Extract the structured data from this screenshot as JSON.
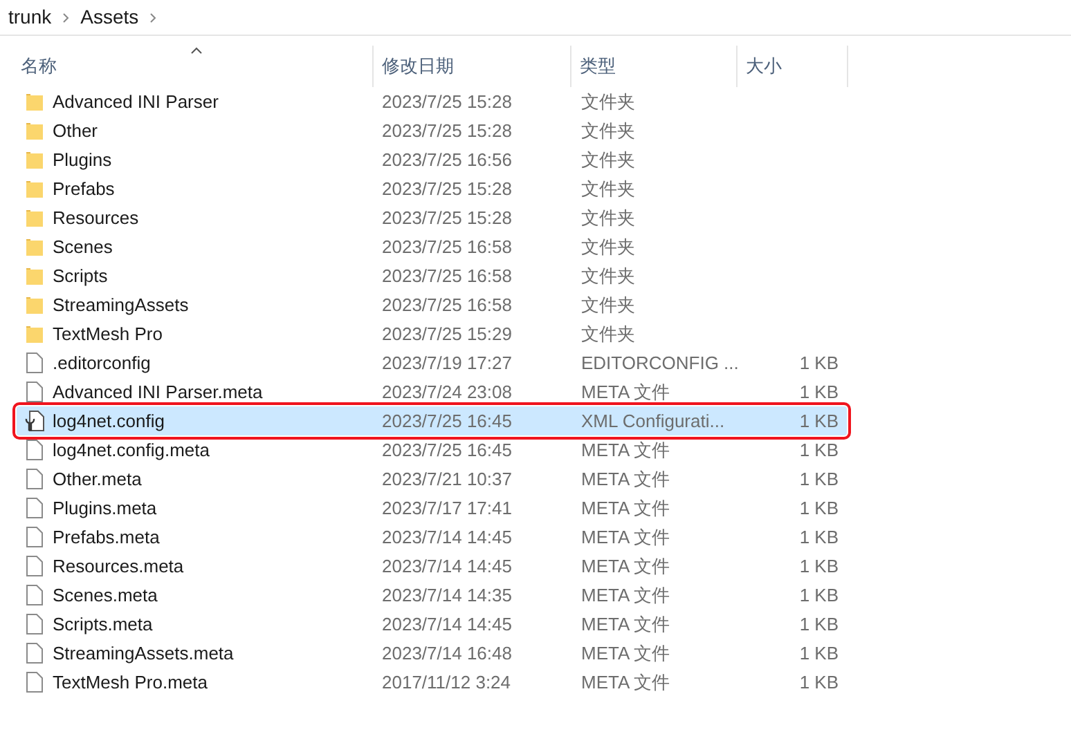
{
  "breadcrumb": [
    "trunk",
    "Assets"
  ],
  "columns": [
    {
      "label": "名称",
      "sorted": true
    },
    {
      "label": "修改日期",
      "sorted": false
    },
    {
      "label": "类型",
      "sorted": false
    },
    {
      "label": "大小",
      "sorted": false
    }
  ],
  "rows": [
    {
      "kind": "folder",
      "name": "Advanced INI Parser",
      "date": "2023/7/25 15:28",
      "type": "文件夹",
      "selected": false,
      "outlined": false
    },
    {
      "kind": "folder",
      "name": "Other",
      "date": "2023/7/25 15:28",
      "type": "文件夹",
      "selected": false,
      "outlined": false
    },
    {
      "kind": "folder",
      "name": "Plugins",
      "date": "2023/7/25 16:56",
      "type": "文件夹",
      "selected": false,
      "outlined": false
    },
    {
      "kind": "folder",
      "name": "Prefabs",
      "date": "2023/7/25 15:28",
      "type": "文件夹",
      "selected": false,
      "outlined": false
    },
    {
      "kind": "folder",
      "name": "Resources",
      "date": "2023/7/25 15:28",
      "type": "文件夹",
      "selected": false,
      "outlined": false
    },
    {
      "kind": "folder",
      "name": "Scenes",
      "date": "2023/7/25 16:58",
      "type": "文件夹",
      "selected": false,
      "outlined": false
    },
    {
      "kind": "folder",
      "name": "Scripts",
      "date": "2023/7/25 16:58",
      "type": "文件夹",
      "selected": false,
      "outlined": false
    },
    {
      "kind": "folder",
      "name": "StreamingAssets",
      "date": "2023/7/25 16:58",
      "type": "文件夹",
      "selected": false,
      "outlined": false
    },
    {
      "kind": "folder",
      "name": "TextMesh Pro",
      "date": "2023/7/25 15:29",
      "type": "文件夹",
      "selected": false,
      "outlined": false
    },
    {
      "kind": "file",
      "name": ".editorconfig",
      "date": "2023/7/19 17:27",
      "type": "EDITORCONFIG ...",
      "size": "1 KB",
      "selected": false,
      "outlined": false
    },
    {
      "kind": "file",
      "name": "Advanced INI Parser.meta",
      "date": "2023/7/24 23:08",
      "type": "META 文件",
      "size": "1 KB",
      "selected": false,
      "outlined": false
    },
    {
      "kind": "config",
      "name": "log4net.config",
      "date": "2023/7/25 16:45",
      "type": "XML Configurati...",
      "size": "1 KB",
      "selected": true,
      "outlined": true
    },
    {
      "kind": "file",
      "name": "log4net.config.meta",
      "date": "2023/7/25 16:45",
      "type": "META 文件",
      "size": "1 KB",
      "selected": false,
      "outlined": false
    },
    {
      "kind": "file",
      "name": "Other.meta",
      "date": "2023/7/21 10:37",
      "type": "META 文件",
      "size": "1 KB",
      "selected": false,
      "outlined": false
    },
    {
      "kind": "file",
      "name": "Plugins.meta",
      "date": "2023/7/17 17:41",
      "type": "META 文件",
      "size": "1 KB",
      "selected": false,
      "outlined": false
    },
    {
      "kind": "file",
      "name": "Prefabs.meta",
      "date": "2023/7/14 14:45",
      "type": "META 文件",
      "size": "1 KB",
      "selected": false,
      "outlined": false
    },
    {
      "kind": "file",
      "name": "Resources.meta",
      "date": "2023/7/14 14:45",
      "type": "META 文件",
      "size": "1 KB",
      "selected": false,
      "outlined": false
    },
    {
      "kind": "file",
      "name": "Scenes.meta",
      "date": "2023/7/14 14:35",
      "type": "META 文件",
      "size": "1 KB",
      "selected": false,
      "outlined": false
    },
    {
      "kind": "file",
      "name": "Scripts.meta",
      "date": "2023/7/14 14:45",
      "type": "META 文件",
      "size": "1 KB",
      "selected": false,
      "outlined": false
    },
    {
      "kind": "file",
      "name": "StreamingAssets.meta",
      "date": "2023/7/14 16:48",
      "type": "META 文件",
      "size": "1 KB",
      "selected": false,
      "outlined": false
    },
    {
      "kind": "file",
      "name": "TextMesh Pro.meta",
      "date": "2017/11/12 3:24",
      "type": "META 文件",
      "size": "1 KB",
      "selected": false,
      "outlined": false
    }
  ]
}
